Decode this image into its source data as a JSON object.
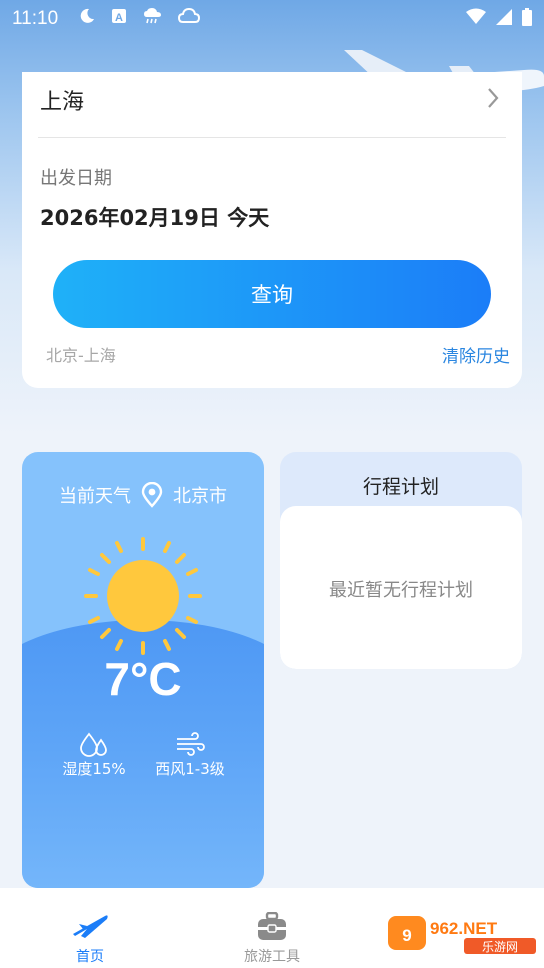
{
  "status_bar": {
    "time": "11:10",
    "icons": [
      "moon-icon",
      "a-notification-icon",
      "cloud-rain-icon",
      "cloud-icon"
    ],
    "right_icons": [
      "wifi-icon",
      "signal-icon",
      "battery-icon"
    ]
  },
  "query_card": {
    "destination_city": "上海",
    "date_label": "出发日期",
    "date_value": "2026年02月19日 今天",
    "search_button": "查询",
    "history_item": "北京-上海",
    "clear_history": "清除历史"
  },
  "weather": {
    "title": "当前天气",
    "city": "北京市",
    "temperature": "7°C",
    "humidity": "湿度15%",
    "wind": "西风1-3级"
  },
  "trip_plan": {
    "title": "行程计划",
    "empty_text": "最近暂无行程计划"
  },
  "tabbar": {
    "home": "首页",
    "tools": "旅游工具"
  },
  "watermark": {
    "text": "962.NET 乐游网"
  },
  "colors": {
    "accent_blue": "#1b7df8",
    "link_blue": "#2a86e0",
    "weather_bg": "#85c2fc"
  }
}
